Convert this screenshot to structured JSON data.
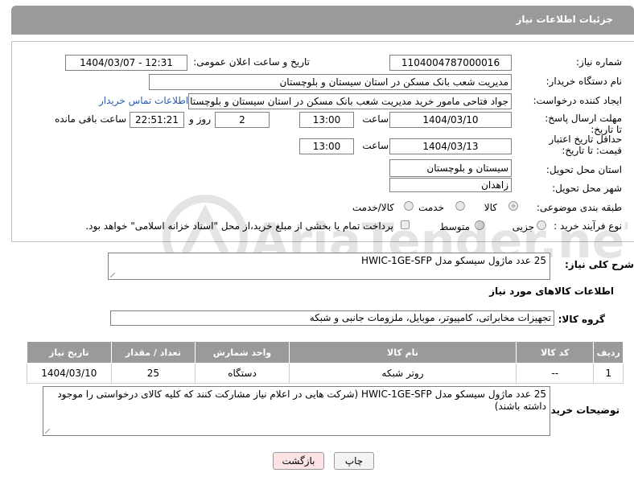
{
  "header": {
    "title": "جزئیات اطلاعات نیاز"
  },
  "fields": {
    "need_number_label": "شماره نیاز:",
    "need_number": "1104004787000016",
    "announce_label": "تاریخ و ساعت اعلان عمومی:",
    "announce_value": "1404/03/07 - 12:31",
    "buyer_org_label": "نام دستگاه خریدار:",
    "buyer_org": "مدیریت شعب بانک مسکن در استان سیستان و بلوچستان",
    "requester_label": "ایجاد کننده درخواست:",
    "requester": "جواد  فتاحی مامور خرید مدیریت شعب بانک مسکن در استان سیستان و بلوچستان",
    "contact_link": "اطلاعات تماس خریدار",
    "reply_deadline_label": "مهلت ارسال پاسخ: تا تاریخ:",
    "reply_date": "1404/03/10",
    "time_label": "ساعت",
    "reply_time": "13:00",
    "days_value": "2",
    "days_label": "روز و",
    "remaining_time": "22:51:21",
    "remaining_label": "ساعت باقی مانده",
    "price_validity_label": "حداقل تاریخ اعتبار قیمت: تا تاریخ:",
    "price_date": "1404/03/13",
    "price_time": "13:00",
    "province_label": "استان محل تحویل:",
    "province": "سیستان و بلوچستان",
    "city_label": "شهر محل تحویل:",
    "city": "زاهدان",
    "category_label": "طبقه بندی موضوعی:",
    "category_options": [
      "کالا",
      "خدمت",
      "کالا/خدمت"
    ],
    "process_label": "نوع فرآیند خرید :",
    "process_options": [
      "جزیی",
      "متوسط"
    ],
    "payment_note": "پرداخت تمام یا بخشی از مبلغ خرید،از محل \"اسناد خزانه اسلامی\" خواهد بود."
  },
  "description": {
    "label": "شرح کلی نیاز:",
    "value": "25 عدد ماژول سیسکو مدل HWIC-1GE-SFP"
  },
  "goods": {
    "section_title": "اطلاعات کالاهای مورد نیاز",
    "group_label": "گروه کالا:",
    "group_value": "تجهیزات مخابراتی، کامپیوتر، موبایل، ملزومات جانبی و شبکه",
    "columns": [
      "ردیف",
      "کد کالا",
      "نام کالا",
      "واحد شمارش",
      "تعداد / مقدار",
      "تاریخ نیاز"
    ],
    "rows": [
      {
        "row": "1",
        "code": "--",
        "name": "روتر شبکه",
        "unit": "دستگاه",
        "qty": "25",
        "date": "1404/03/10"
      }
    ]
  },
  "buyer_notes": {
    "label": "توضیحات خریدار:",
    "value": "25 عدد ماژول سیسکو مدل HWIC-1GE-SFP (شرکت هایی در اعلام نیاز مشارکت کنند که کلیه کالای درخواستی را موجود داشته باشند)"
  },
  "buttons": {
    "print": "چاپ",
    "back": "بازگشت"
  },
  "watermark": {
    "text": "AriaTender.neT"
  },
  "colors": {
    "header_bg": "#9a9a9a",
    "link": "#2a5db0",
    "back_button_bg": "#fbe3e3"
  }
}
